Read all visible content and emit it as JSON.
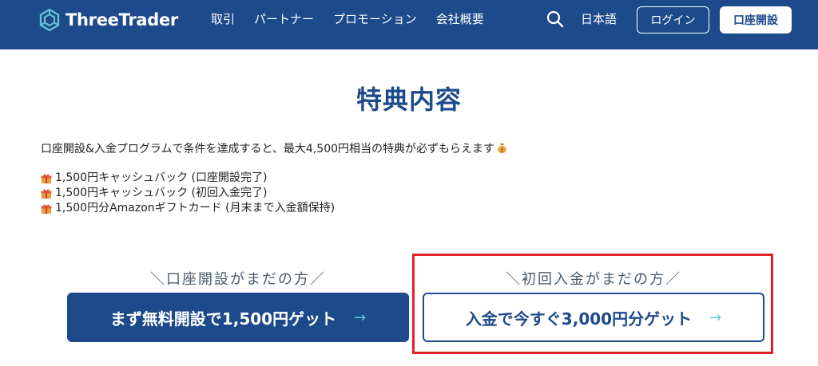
{
  "header": {
    "logo_text": "ThreeTrader",
    "nav": [
      "取引",
      "パートナー",
      "プロモーション",
      "会社概要"
    ],
    "search_icon": "search-icon",
    "language": "日本語",
    "login_label": "ログイン",
    "open_account_label": "口座開設"
  },
  "main": {
    "title": "特典内容",
    "intro": "口座開設&入金プログラムで条件を達成すると、最大4,500円相当の特典が必ずもらえます",
    "benefits": [
      "1,500円キャッシュバック (口座開設完了)",
      "1,500円キャッシュバック (初回入金完了)",
      "1,500円分Amazonギフトカード (月末まで入金額保持)"
    ],
    "cta_left": {
      "label": "＼口座開設がまだの方／",
      "button": "まず無料開設で1,500円ゲット",
      "arrow": "→"
    },
    "cta_right": {
      "label": "＼初回入金がまだの方／",
      "button": "入金で今すぐ3,000円分ゲット",
      "arrow": "→"
    }
  },
  "colors": {
    "brand": "#1d4a8b",
    "accent_arrow": "#63c6d4",
    "highlight": "#e0222a"
  }
}
